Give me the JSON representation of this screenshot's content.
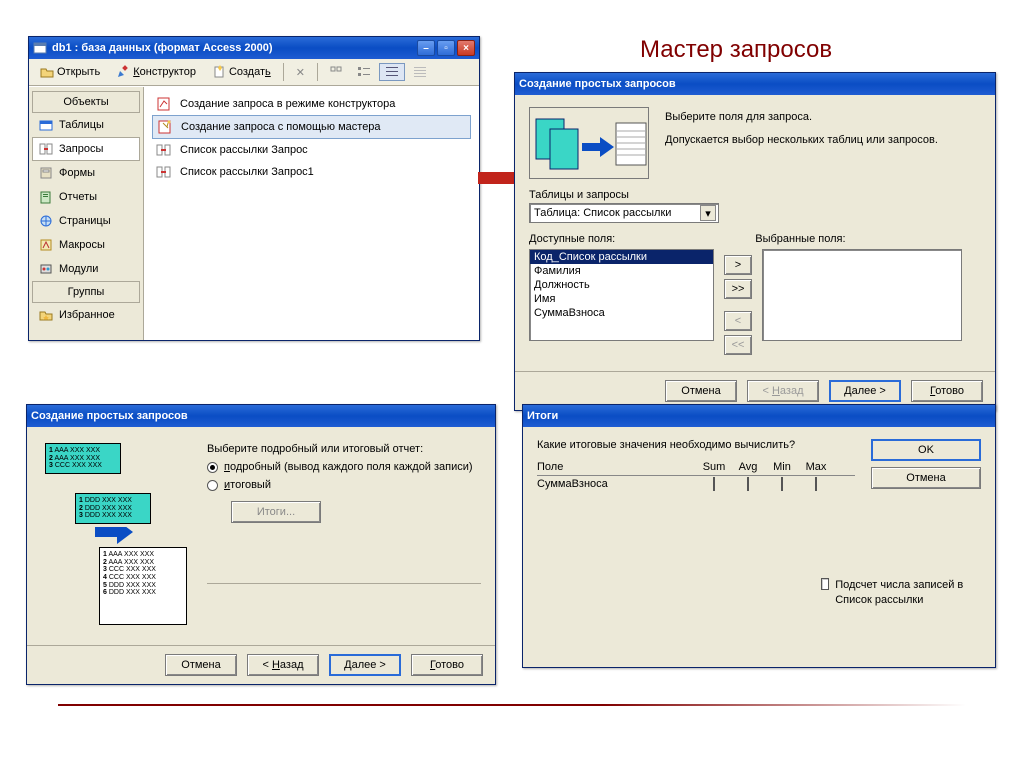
{
  "page": {
    "title": "Мастер запросов"
  },
  "db": {
    "title": "db1 : база данных (формат Access 2000)",
    "toolbar": {
      "open": "Открыть",
      "design": "Конструктор",
      "create": "Создать"
    },
    "nav": {
      "objects_head": "Объекты",
      "groups_head": "Группы",
      "items": [
        {
          "label": "Таблицы"
        },
        {
          "label": "Запросы"
        },
        {
          "label": "Формы"
        },
        {
          "label": "Отчеты"
        },
        {
          "label": "Страницы"
        },
        {
          "label": "Макросы"
        },
        {
          "label": "Модули"
        }
      ],
      "fav": "Избранное"
    },
    "list": [
      {
        "label": "Создание запроса в режиме конструктора"
      },
      {
        "label": "Создание запроса с помощью мастера"
      },
      {
        "label": "Список рассылки Запрос"
      },
      {
        "label": "Список рассылки Запрос1"
      }
    ]
  },
  "wiz1": {
    "title": "Создание простых запросов",
    "prompt1": "Выберите поля для запроса.",
    "prompt2": "Допускается выбор нескольких таблиц или запросов.",
    "tq_label": "Таблицы и запросы",
    "combo": "Таблица: Список рассылки",
    "avail_label": "Доступные поля:",
    "sel_label": "Выбранные поля:",
    "fields": [
      "Код_Список рассылки",
      "Фамилия",
      "Должность",
      "Имя",
      "СуммаВзноса"
    ],
    "buttons": {
      "cancel": "Отмена",
      "back": "< Назад",
      "next": "Далее >",
      "finish": "Готово"
    }
  },
  "wiz2": {
    "title": "Создание простых запросов",
    "prompt": "Выберите подробный или итоговый отчет:",
    "opt1": "подробный (вывод каждого поля каждой записи)",
    "opt2": "итоговый",
    "totals_btn": "Итоги...",
    "buttons": {
      "cancel": "Отмена",
      "back": "< Назад",
      "next": "Далее >",
      "finish": "Готово"
    }
  },
  "totals": {
    "title": "Итоги",
    "prompt": "Какие итоговые значения необходимо вычислить?",
    "cols": {
      "field": "Поле",
      "sum": "Sum",
      "avg": "Avg",
      "min": "Min",
      "max": "Max"
    },
    "rows": [
      {
        "field": "СуммаВзноса"
      }
    ],
    "ok": "OK",
    "cancel": "Отмена",
    "count": "Подсчет числа записей в Список рассылки"
  }
}
